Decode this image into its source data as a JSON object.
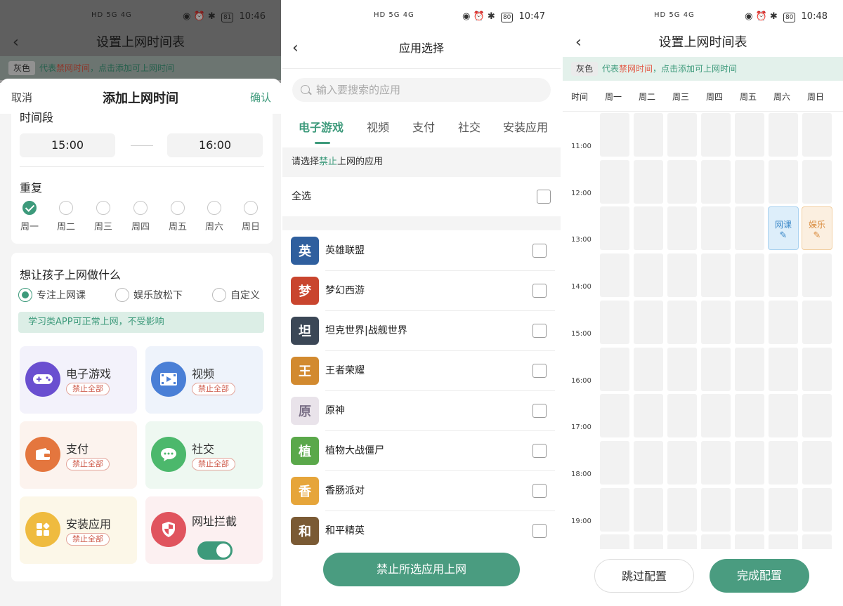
{
  "colors": {
    "accent": "#3d9a7b",
    "warn": "#e35b48",
    "button": "#4a9c80"
  },
  "screens": [
    {
      "status": {
        "left": "HD 5G 4G",
        "time": "10:46",
        "battery": "81"
      },
      "header": {
        "title": "设置上网时间表"
      },
      "legend": {
        "gray": "灰色",
        "pre": "代表",
        "forbid": "禁网时间",
        "post": "，点击添加可上网时间"
      },
      "sheet": {
        "cancel": "取消",
        "title": "添加上网时间",
        "confirm": "确认",
        "time_label": "时间段",
        "start": "15:00",
        "end": "16:00",
        "repeat_label": "重复",
        "days": [
          "周一",
          "周二",
          "周三",
          "周四",
          "周五",
          "周六",
          "周日"
        ],
        "what_label": "想让孩子上网做什么",
        "modes": [
          "专注上网课",
          "娱乐放松下",
          "自定义"
        ],
        "tip": "学习类APP可正常上网，不受影响",
        "tiles": [
          {
            "name": "电子游戏",
            "badge": "禁止全部",
            "icon": "gamepad-icon"
          },
          {
            "name": "视频",
            "badge": "禁止全部",
            "icon": "video-icon"
          },
          {
            "name": "支付",
            "badge": "禁止全部",
            "icon": "wallet-icon"
          },
          {
            "name": "社交",
            "badge": "禁止全部",
            "icon": "chat-icon"
          },
          {
            "name": "安装应用",
            "badge": "禁止全部",
            "icon": "apps-icon"
          },
          {
            "name": "网址拦截",
            "icon": "shield-icon"
          }
        ]
      }
    },
    {
      "status": {
        "left": "HD 5G 4G",
        "time": "10:47",
        "battery": "80"
      },
      "header": {
        "title": "应用选择"
      },
      "search": {
        "placeholder": "输入要搜索的应用"
      },
      "tabs": [
        "电子游戏",
        "视频",
        "支付",
        "社交",
        "安装应用"
      ],
      "hint": {
        "pre": "请选择",
        "forbid": "禁止",
        "post": "上网的应用"
      },
      "select_all": "全选",
      "apps": [
        {
          "name": "英雄联盟",
          "color": "#2f5f9e"
        },
        {
          "name": "梦幻西游",
          "color": "#c9452e"
        },
        {
          "name": "坦克世界|战舰世界",
          "color": "#3b4756"
        },
        {
          "name": "王者荣耀",
          "color": "#d28a2f"
        },
        {
          "name": "原神",
          "color": "#e9e3ea"
        },
        {
          "name": "植物大战僵尸",
          "color": "#5aa84a"
        },
        {
          "name": "香肠派对",
          "color": "#e6a53a"
        },
        {
          "name": "和平精英",
          "color": "#7a5a34"
        }
      ],
      "button": "禁止所选应用上网"
    },
    {
      "status": {
        "left": "HD 5G 4G",
        "time": "10:48",
        "battery": "80"
      },
      "header": {
        "title": "设置上网时间表"
      },
      "legend": {
        "gray": "灰色",
        "pre": "代表",
        "forbid": "禁网时间",
        "post": "，点击添加可上网时间"
      },
      "columns": [
        "时间",
        "周一",
        "周二",
        "周三",
        "周四",
        "周五",
        "周六",
        "周日"
      ],
      "times": [
        "11:00",
        "12:00",
        "13:00",
        "14:00",
        "15:00",
        "16:00",
        "17:00",
        "18:00",
        "19:00"
      ],
      "slots": [
        {
          "label": "网课",
          "day": "周六",
          "start": "12:00",
          "end": "13:00"
        },
        {
          "label": "娱乐",
          "day": "周日",
          "start": "12:00",
          "end": "13:00"
        }
      ],
      "skip": "跳过配置",
      "done": "完成配置"
    }
  ]
}
